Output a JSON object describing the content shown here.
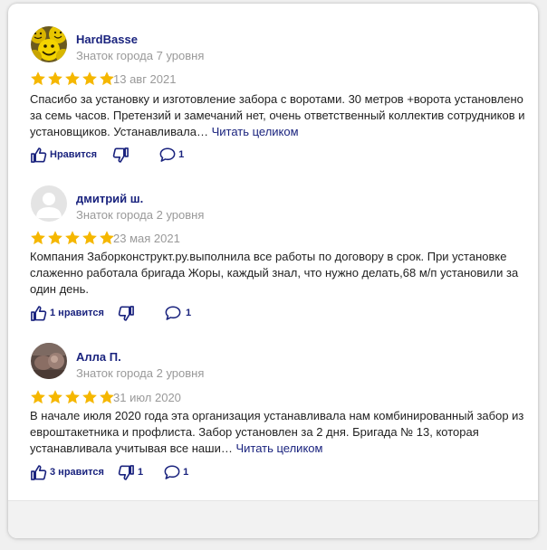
{
  "theme": {
    "star_color": "#f5b700",
    "link_color": "#1a237e",
    "muted_color": "#999999"
  },
  "reviews": [
    {
      "author": "HardBasse",
      "level": "Знаток города 7 уровня",
      "avatar": "smiley-faces-avatar",
      "rating": 5,
      "date": "13 авг 2021",
      "text": "Спасибо за установку и изготовление забора с воротами. 30 метров +ворота установлено за семь часов. Претензий и замечаний нет, очень ответственный коллектив сотрудников и установщиков. Устанавливала…",
      "read_more": "Читать целиком",
      "likes_label": "Нравится",
      "comments_count": "1"
    },
    {
      "author": "дмитрий ш.",
      "level": "Знаток города 2 уровня",
      "avatar": "default-user-avatar",
      "rating": 5,
      "date": "23 мая 2021",
      "text": "Компания Заборконструкт.ру.выполнила все работы по договору в срок. При установке слаженно работала бригада Жоры, каждый знал, что нужно делать,68 м/п установили за один день.",
      "read_more": "",
      "likes_label": "1 нравится",
      "comments_count": "1"
    },
    {
      "author": "Алла П.",
      "level": "Знаток города 2 уровня",
      "avatar": "photo-avatar",
      "rating": 5,
      "date": "31 июл 2020",
      "text": "В начале июля 2020 года эта организация устанавливала нам комбинированный забор из евроштакетника и профлиста. Забор установлен за 2 дня. Бригада № 13, которая устанавливала учитывая все наши…",
      "read_more": "Читать целиком",
      "likes_label": "3 нравится",
      "dislikes_count": "1",
      "comments_count": "1"
    }
  ]
}
